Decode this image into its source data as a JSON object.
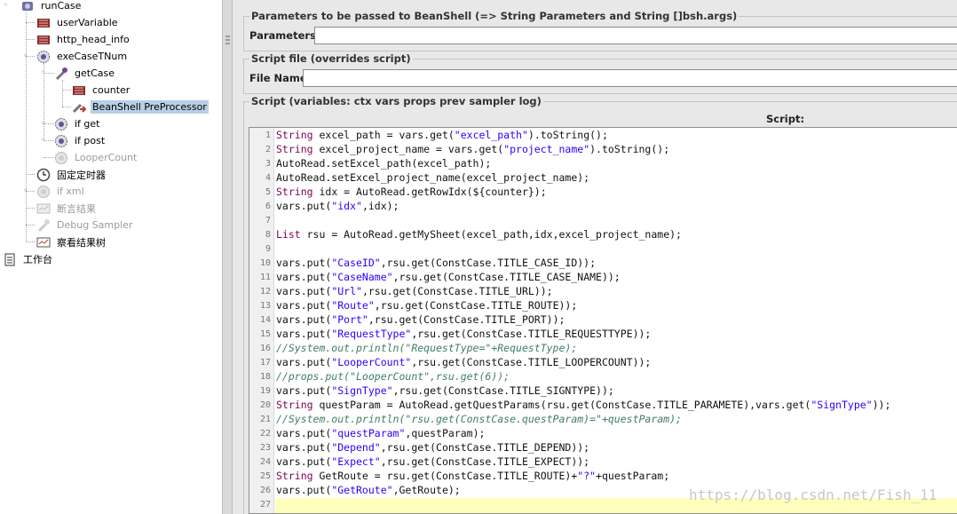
{
  "tree": {
    "root_label": "runCase",
    "items": [
      {
        "label": "userVariable"
      },
      {
        "label": "http_head_info"
      },
      {
        "label": "exeCaseTNum"
      },
      {
        "label": "getCase"
      },
      {
        "label": "counter"
      },
      {
        "label": "BeanShell PreProcessor"
      },
      {
        "label": "if get"
      },
      {
        "label": "if post"
      },
      {
        "label": "LooperCount"
      },
      {
        "label": "固定定时器"
      },
      {
        "label": "if xml"
      },
      {
        "label": "断言结果"
      },
      {
        "label": "Debug Sampler"
      },
      {
        "label": "察看结果树"
      }
    ],
    "workbench_label": "工作台"
  },
  "params": {
    "title": "Parameters to be passed to BeanShell (=> String Parameters and String []bsh.args)",
    "label": "Parameters:",
    "value": ""
  },
  "script_file": {
    "title": "Script file (overrides script)",
    "label": "File Name:",
    "value": ""
  },
  "script": {
    "title": "Script (variables: ctx vars props prev sampler log)",
    "label": "Script:",
    "lines": [
      "String excel_path = vars.get(\"excel_path\").toString();",
      "String excel_project_name = vars.get(\"project_name\").toString();",
      "AutoRead.setExcel_path(excel_path);",
      "AutoRead.setExcel_project_name(excel_project_name);",
      "String idx = AutoRead.getRowIdx(${counter});",
      "vars.put(\"idx\",idx);",
      "",
      "List rsu = AutoRead.getMySheet(excel_path,idx,excel_project_name);",
      "",
      "vars.put(\"CaseID\",rsu.get(ConstCase.TITLE_CASE_ID));",
      "vars.put(\"CaseName\",rsu.get(ConstCase.TITLE_CASE_NAME));",
      "vars.put(\"Url\",rsu.get(ConstCase.TITLE_URL));",
      "vars.put(\"Route\",rsu.get(ConstCase.TITLE_ROUTE));",
      "vars.put(\"Port\",rsu.get(ConstCase.TITLE_PORT));",
      "vars.put(\"RequestType\",rsu.get(ConstCase.TITLE_REQUESTTYPE));",
      "//System.out.println(\"RequestType=\"+RequestType);",
      "vars.put(\"LooperCount\",rsu.get(ConstCase.TITLE_LOOPERCOUNT));",
      "//props.put(\"LooperCount\",rsu.get(6));",
      "vars.put(\"SignType\",rsu.get(ConstCase.TITLE_SIGNTYPE));",
      "String questParam = AutoRead.getQuestParams(rsu.get(ConstCase.TITLE_PARAMETE),vars.get(\"SignType\"));",
      "//System.out.println(\"rsu.get(ConstCase.questParam)=\"+questParam);",
      "vars.put(\"questParam\",questParam);",
      "vars.put(\"Depend\",rsu.get(ConstCase.TITLE_DEPEND));",
      "vars.put(\"Expect\",rsu.get(ConstCase.TITLE_EXPECT));",
      "String GetRoute = rsu.get(ConstCase.TITLE_ROUTE)+\"?\"+questParam;",
      "vars.put(\"GetRoute\",GetRoute);",
      ""
    ]
  },
  "watermark": "https://blog.csdn.net/Fish_11",
  "colors": {
    "keyword": "#7f0055",
    "string": "#2a00ff",
    "comment": "#3f7f5f",
    "selection": "#b8cfe5",
    "current_line": "#ffffbd"
  }
}
